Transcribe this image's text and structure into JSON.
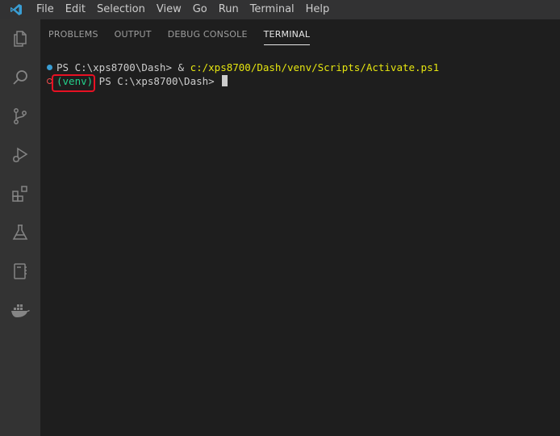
{
  "menubar": {
    "items": [
      "File",
      "Edit",
      "Selection",
      "View",
      "Go",
      "Run",
      "Terminal",
      "Help"
    ]
  },
  "activitybar": {
    "icons": [
      "explorer-icon",
      "search-icon",
      "source-control-icon",
      "run-debug-icon",
      "extensions-icon",
      "testing-icon",
      "notebook-icon",
      "docker-icon"
    ]
  },
  "panel": {
    "tabs": [
      {
        "label": "PROBLEMS"
      },
      {
        "label": "OUTPUT"
      },
      {
        "label": "DEBUG CONSOLE"
      },
      {
        "label": "TERMINAL",
        "active": true
      }
    ]
  },
  "terminal": {
    "line1": {
      "prompt": "PS C:\\xps8700\\Dash> ",
      "operator": "& ",
      "command": "c:/xps8700/Dash/venv/Scripts/Activate.ps1"
    },
    "line2": {
      "venv": "(venv)",
      "prompt": " PS C:\\xps8700\\Dash> "
    }
  },
  "colors": {
    "accent_blue": "#3a9ed4",
    "venv_green": "#23d18b",
    "path_yellow": "#e5e510",
    "highlight_red": "#e81123"
  }
}
